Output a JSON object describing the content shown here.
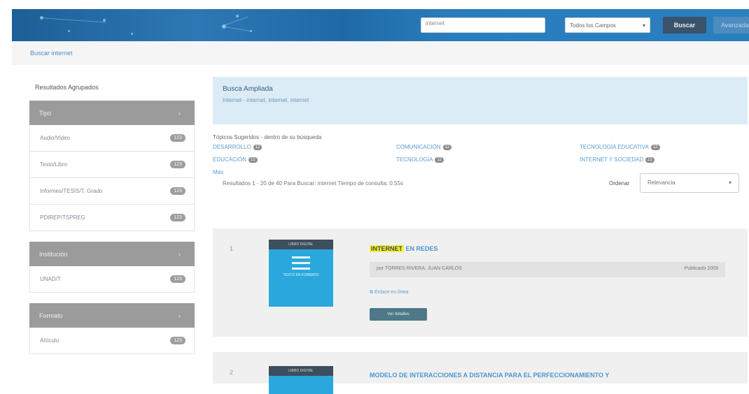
{
  "header": {
    "search_placeholder": "internet",
    "scope": "Todos los Campos",
    "buscar": "Buscar",
    "avanzada": "Avanzada"
  },
  "breadcrumb": "Buscar internet",
  "sidebar": {
    "title": "Resultados Agrupados",
    "groups": [
      {
        "label": "Tipo",
        "items": [
          {
            "label": "Audio/Video",
            "count": "123"
          },
          {
            "label": "Texto/Libro",
            "count": "123"
          },
          {
            "label": "Informes/TESIS/T. Grado",
            "count": "123"
          },
          {
            "label": "PDIREP/TSPREG",
            "count": "123"
          }
        ]
      },
      {
        "label": "Institución",
        "items": [
          {
            "label": "UNAD/T",
            "count": "123"
          }
        ]
      },
      {
        "label": "Formato",
        "items": [
          {
            "label": "Artículo",
            "count": "123"
          }
        ]
      }
    ]
  },
  "alert": {
    "title": "Busca Ampliada",
    "sub": "Internet - internet, internet, internet"
  },
  "topics": {
    "label": "Tópicos Sugeridos - dentro de su búsqueda",
    "items": [
      {
        "label": "DESARROLLO",
        "count": "12"
      },
      {
        "label": "EDUCACIÓN",
        "count": "12"
      },
      {
        "label": "COMUNICACIÓN",
        "count": "12"
      },
      {
        "label": "TECNOLOGÍA",
        "count": "12"
      },
      {
        "label": "TECNOLOGÍA EDUCATIVA",
        "count": "12"
      },
      {
        "label": "INTERNET Y SOCIEDAD",
        "count": "12"
      },
      {
        "label": "Más",
        "count": ""
      }
    ],
    "results_line": "Resultados 1 - 20 de 40 Para Buscar: internet Tiempo de consulta: 0.55s",
    "orden_label": "Ordenar",
    "orden_value": "Relevancia"
  },
  "results": [
    {
      "num": "1",
      "title_hl": "INTERNET",
      "title_rest": "EN REDES",
      "meta_left": "por TORRES RIVERA, JUAN CARLOS",
      "meta_right": "Publicado 2009",
      "link": "Enlace en línea",
      "btn": "Ver detalles",
      "thumb_top": "LIBRO DIGITAL",
      "thumb_text": "TEXTO EN FORMATO"
    },
    {
      "num": "2",
      "title_hl": "",
      "title_rest": "MODELO DE INTERACCIONES A DISTANCIA PARA EL PERFECCIONAMIENTO Y",
      "thumb_top": "LIBRO DIGITAL"
    }
  ]
}
